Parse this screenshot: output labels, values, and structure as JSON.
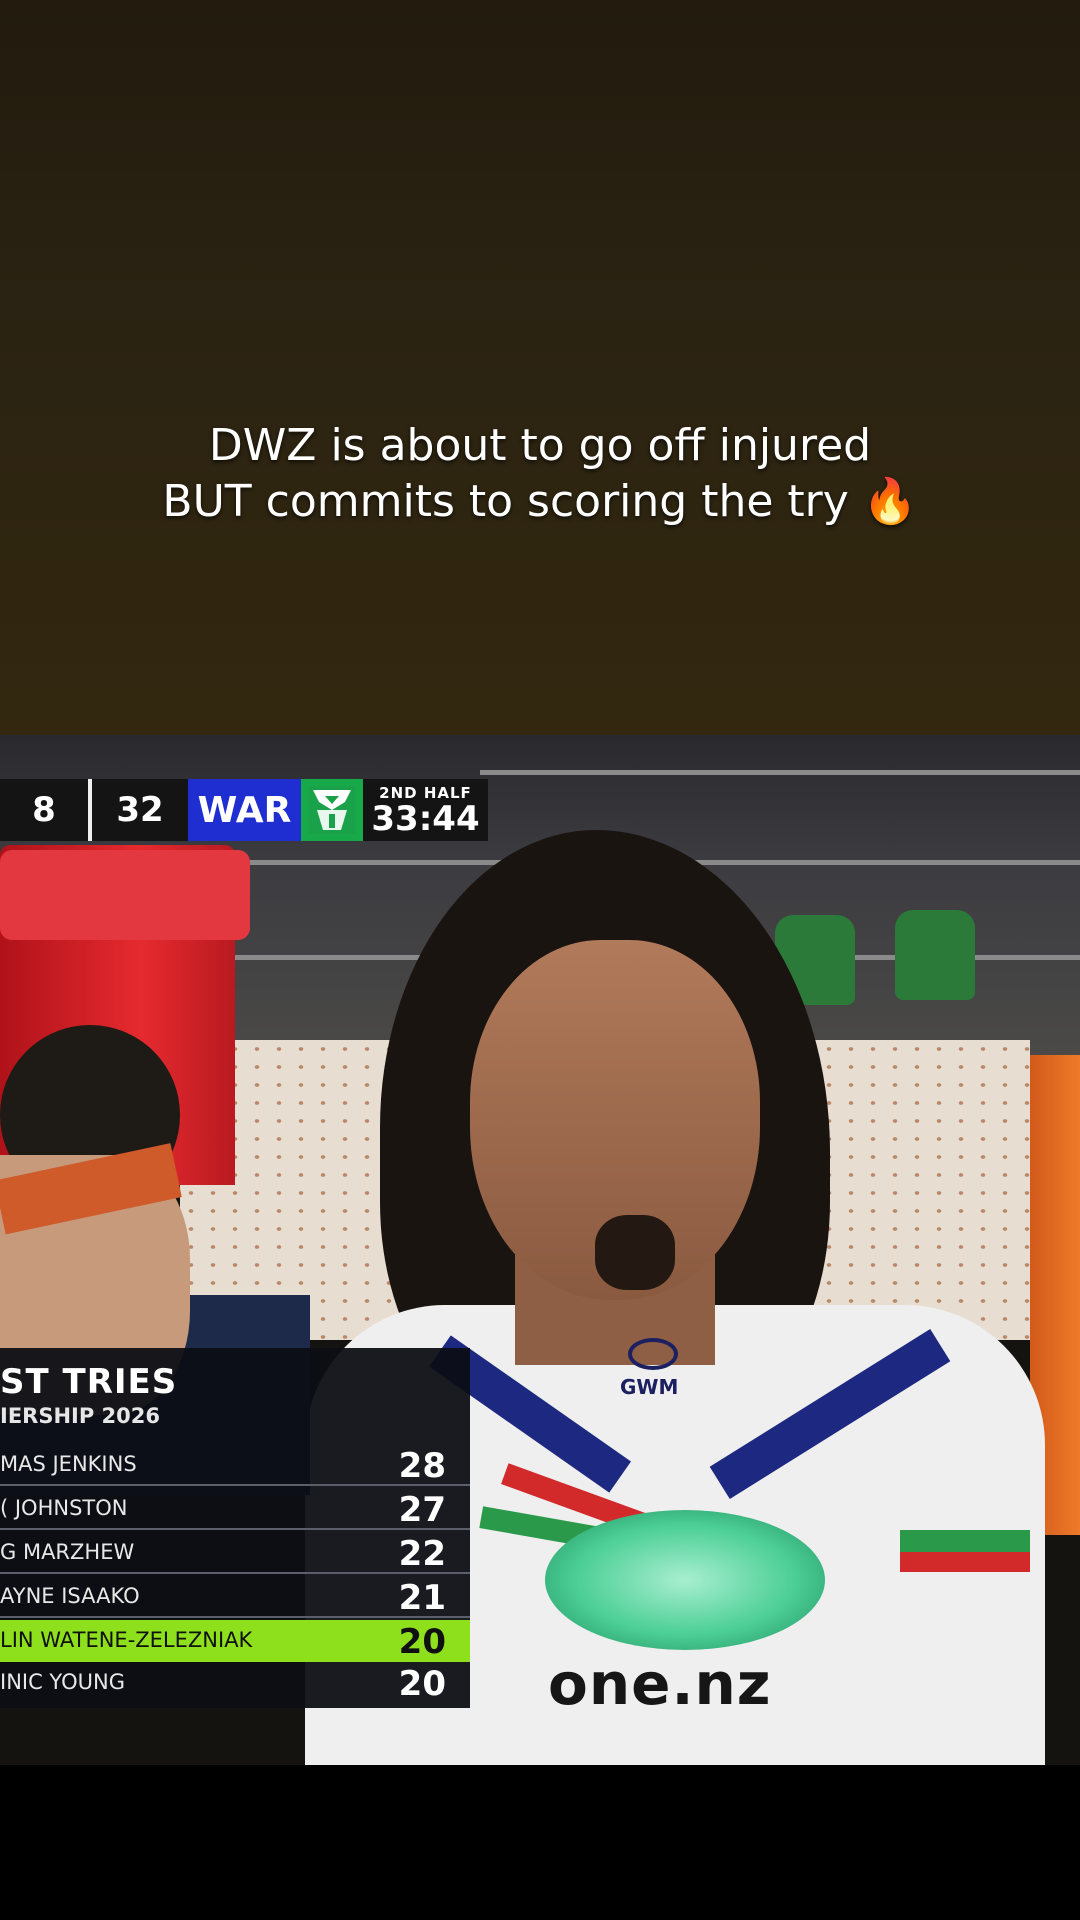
{
  "caption": {
    "line1": "DWZ is about to go off injured",
    "line2": "BUT commits to scoring the try",
    "emoji": "🔥"
  },
  "scorebug": {
    "home_score": "8",
    "away_score": "32",
    "away_team": "WAR",
    "half": "2ND HALF",
    "clock": "33:44",
    "colors": {
      "team_bg": "#1f2ed0",
      "logo_bg": "#17a84a",
      "bug_bg": "#141414"
    }
  },
  "tries_table": {
    "title": "ST TRIES",
    "subtitle": "IERSHIP 2026",
    "rows": [
      {
        "name": "MAS JENKINS",
        "tries": "28"
      },
      {
        "name": "( JOHNSTON",
        "tries": "27"
      },
      {
        "name": "G MARZHEW",
        "tries": "22"
      },
      {
        "name": "AYNE ISAAKO",
        "tries": "21"
      },
      {
        "name": "LIN WATENE-ZELEZNIAK",
        "tries": "20",
        "highlighted": true
      },
      {
        "name": "INIC YOUNG",
        "tries": "20"
      }
    ],
    "highlight_color": "#8ee01c"
  },
  "jersey": {
    "chest_sponsor": "GWM",
    "main_sponsor": "one.nz"
  }
}
